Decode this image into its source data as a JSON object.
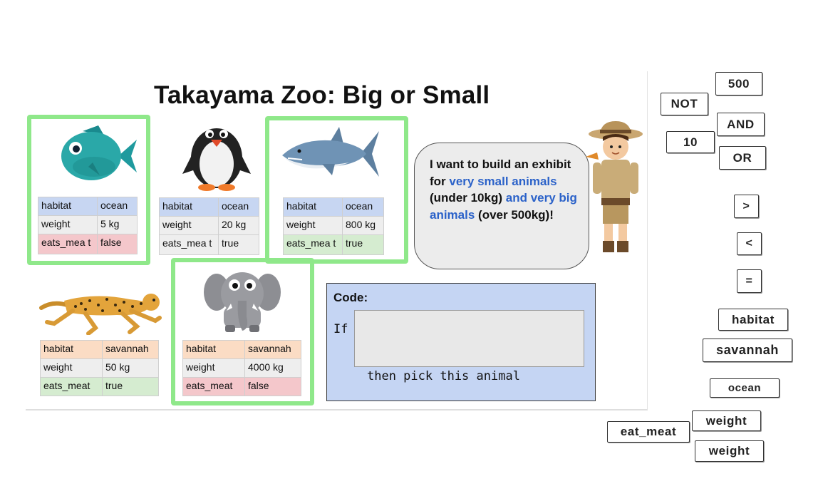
{
  "title": "Takayama Zoo: Big or Small",
  "labels": {
    "habitat": "habitat",
    "weight": "weight",
    "eats_meat": "eats_meat",
    "eats_meat_wrapped": "eats_mea t"
  },
  "animals": {
    "fish": {
      "habitat": "ocean",
      "weight": "5 kg",
      "eats_meat": "false"
    },
    "penguin": {
      "habitat": "ocean",
      "weight": "20 kg",
      "eats_meat": "true"
    },
    "shark": {
      "habitat": "ocean",
      "weight": "800 kg",
      "eats_meat": "true"
    },
    "cheetah": {
      "habitat": "savannah",
      "weight": "50 kg",
      "eats_meat": "true"
    },
    "elephant": {
      "habitat": "savannah",
      "weight": "4000 kg",
      "eats_meat": "false"
    }
  },
  "bubble": {
    "line1": "I want to build an exhibit for ",
    "hl1": "very small animals",
    "line2": " (under 10kg) ",
    "hl2": "and very big animals",
    "line3": " (over 500kg)!"
  },
  "code": {
    "label": "Code:",
    "if": "If",
    "then": "then pick this animal"
  },
  "blocks": {
    "b500": "500",
    "not": "NOT",
    "and": "AND",
    "b10": "10",
    "or": "OR",
    "gt": ">",
    "lt": "<",
    "eq": "=",
    "habitat": "habitat",
    "savannah": "savannah",
    "ocean": "ocean",
    "weight1": "weight",
    "eat_meat": "eat_meat",
    "weight2": "weight"
  },
  "colors": {
    "highlight_border": "#8fe88a",
    "bubble_accent": "#2b62c9",
    "code_bg": "#c5d5f3"
  },
  "icons": [
    "fish-icon",
    "penguin-icon",
    "shark-icon",
    "cheetah-icon",
    "elephant-icon",
    "zookeeper-icon"
  ]
}
